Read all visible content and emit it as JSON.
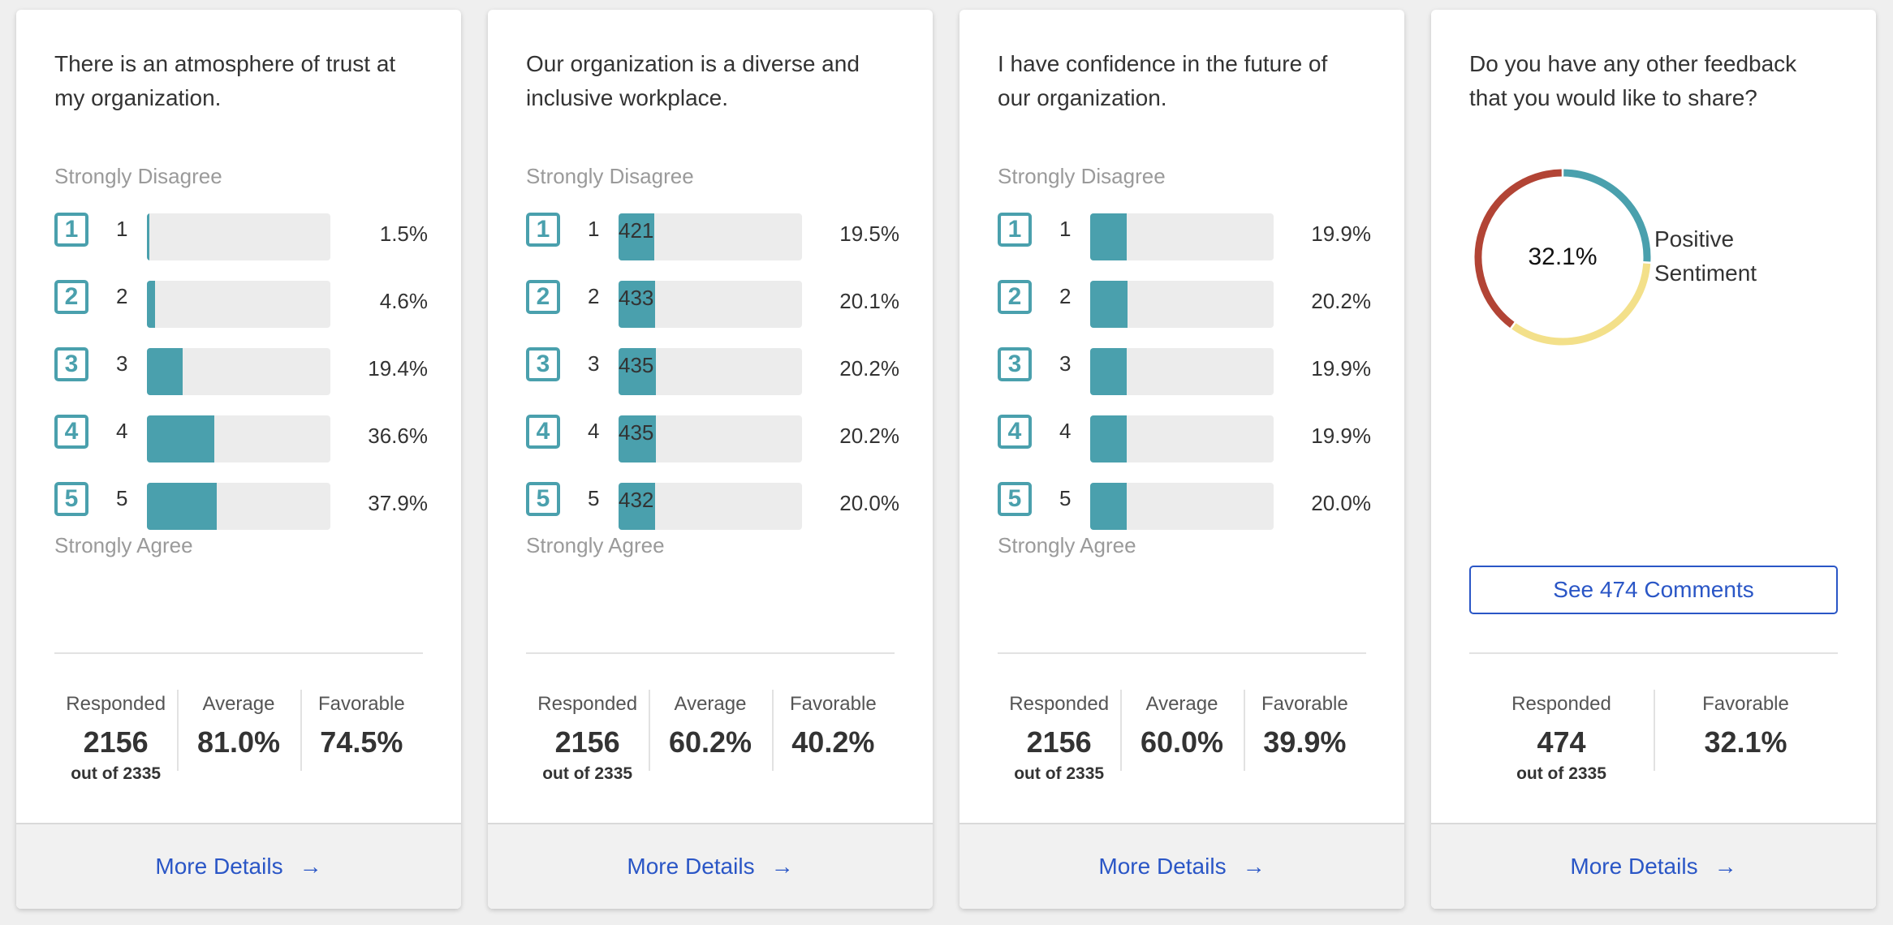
{
  "cards": [
    {
      "question": "There is an atmosphere of trust at my organization.",
      "scale_top": "Strongly Disagree",
      "scale_bottom": "Strongly Agree",
      "rows": [
        {
          "box": "1",
          "label": "1",
          "count": "",
          "pct": "1.5%",
          "fraction": 0.015
        },
        {
          "box": "2",
          "label": "2",
          "count": "",
          "pct": "4.6%",
          "fraction": 0.046
        },
        {
          "box": "3",
          "label": "3",
          "count": "",
          "pct": "19.4%",
          "fraction": 0.194
        },
        {
          "box": "4",
          "label": "4",
          "count": "",
          "pct": "36.6%",
          "fraction": 0.366
        },
        {
          "box": "5",
          "label": "5",
          "count": "",
          "pct": "37.9%",
          "fraction": 0.379
        }
      ],
      "stats": {
        "responded_label": "Responded",
        "responded_value": "2156",
        "responded_sub": "out of 2335",
        "average_label": "Average",
        "average_value": "81.0%",
        "favorable_label": "Favorable",
        "favorable_value": "74.5%"
      },
      "footer": "More Details"
    },
    {
      "question": "Our organization is a diverse and inclusive workplace.",
      "scale_top": "Strongly Disagree",
      "scale_bottom": "Strongly Agree",
      "rows": [
        {
          "box": "1",
          "label": "1",
          "count": "421",
          "pct": "19.5%",
          "fraction": 0.195
        },
        {
          "box": "2",
          "label": "2",
          "count": "433",
          "pct": "20.1%",
          "fraction": 0.201
        },
        {
          "box": "3",
          "label": "3",
          "count": "435",
          "pct": "20.2%",
          "fraction": 0.202
        },
        {
          "box": "4",
          "label": "4",
          "count": "435",
          "pct": "20.2%",
          "fraction": 0.202
        },
        {
          "box": "5",
          "label": "5",
          "count": "432",
          "pct": "20.0%",
          "fraction": 0.2
        }
      ],
      "stats": {
        "responded_label": "Responded",
        "responded_value": "2156",
        "responded_sub": "out of 2335",
        "average_label": "Average",
        "average_value": "60.2%",
        "favorable_label": "Favorable",
        "favorable_value": "40.2%"
      },
      "footer": "More Details"
    },
    {
      "question": "I have confidence in the future of our organization.",
      "scale_top": "Strongly Disagree",
      "scale_bottom": "Strongly Agree",
      "rows": [
        {
          "box": "1",
          "label": "1",
          "count": "",
          "pct": "19.9%",
          "fraction": 0.199
        },
        {
          "box": "2",
          "label": "2",
          "count": "",
          "pct": "20.2%",
          "fraction": 0.202
        },
        {
          "box": "3",
          "label": "3",
          "count": "",
          "pct": "19.9%",
          "fraction": 0.199
        },
        {
          "box": "4",
          "label": "4",
          "count": "",
          "pct": "19.9%",
          "fraction": 0.199
        },
        {
          "box": "5",
          "label": "5",
          "count": "",
          "pct": "20.0%",
          "fraction": 0.2
        }
      ],
      "stats": {
        "responded_label": "Responded",
        "responded_value": "2156",
        "responded_sub": "out of 2335",
        "average_label": "Average",
        "average_value": "60.0%",
        "favorable_label": "Favorable",
        "favorable_value": "39.9%"
      },
      "footer": "More Details"
    }
  ],
  "feedback_card": {
    "question": "Do you have any other feedback that you would like to share?",
    "donut_center": "32.1%",
    "sentiment_label": "Positive Sentiment",
    "donut_segments": [
      {
        "label": "positive",
        "fraction": 0.26,
        "color": "#4aa0ad"
      },
      {
        "label": "neutral",
        "fraction": 0.34,
        "color": "#f3e08a"
      },
      {
        "label": "negative",
        "fraction": 0.4,
        "color": "#b24435"
      }
    ],
    "comments_button": "See 474 Comments",
    "stats": {
      "responded_label": "Responded",
      "responded_value": "474",
      "responded_sub": "out of 2335",
      "favorable_label": "Favorable",
      "favorable_value": "32.1%"
    },
    "footer": "More Details"
  },
  "colors": {
    "accent": "#4aa0ad",
    "link": "#2a56c6",
    "bar_bg": "#ececec"
  },
  "icons": {
    "footer_arrow": "→"
  }
}
